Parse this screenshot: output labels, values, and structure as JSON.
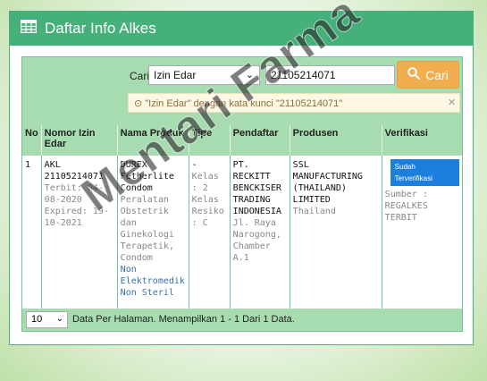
{
  "header": {
    "title": "Daftar Info Alkes",
    "icon": "table-icon"
  },
  "search": {
    "label": "Cari",
    "field_selected": "Izin Edar",
    "keyword_value": "21105214071",
    "button_label": "Cari",
    "alert_text": "\"Izin Edar\" dengan kata kunci \"21105214071\"",
    "alert_close": "×"
  },
  "table": {
    "headers": {
      "no": "No",
      "nomor": "Nomor Izin Edar",
      "nama": "Nama Produk",
      "tipe": "Tipe",
      "pendaftar": "Pendaftar",
      "produsen": "Produsen",
      "verifikasi": "Verifikasi"
    },
    "rows": [
      {
        "no": "1",
        "nomor": "AKL 21105214071",
        "terbit": "Terbit: 04-08-2020",
        "expired": "Expired: 19-10-2021",
        "nama": "DUREX Fetherlite Condom",
        "kategori": "Peralatan Obstetrik dan Ginekologi Terapetik, Condom",
        "jenis": "Non Elektromedik Non Steril",
        "tipe_dash": "-",
        "kelas": "Kelas : 2 Kelas Resiko : C",
        "pendaftar_nama": "PT. RECKITT BENCKISER TRADING INDONESIA",
        "pendaftar_alamat": "Jl. Raya Narogong, Chamber A.1",
        "produsen_nama": "SSL MANUFACTURING (THAILAND) LIMITED",
        "produsen_negara": "Thailand",
        "verifikasi_badge": "Sudah Terverifikasi",
        "verifikasi_sumber": "Sumber : REGALKES TERBIT"
      }
    ]
  },
  "footer": {
    "per_page": "10",
    "info": "Data Per Halaman. Menampilkan 1 - 1 Dari 1 Data."
  },
  "watermark": "Mentari Farma",
  "colors": {
    "header": "#45b07a",
    "table_head": "#a6dcb0",
    "search_button": "#f1ad4e",
    "verified_badge": "#1c7fdd"
  }
}
